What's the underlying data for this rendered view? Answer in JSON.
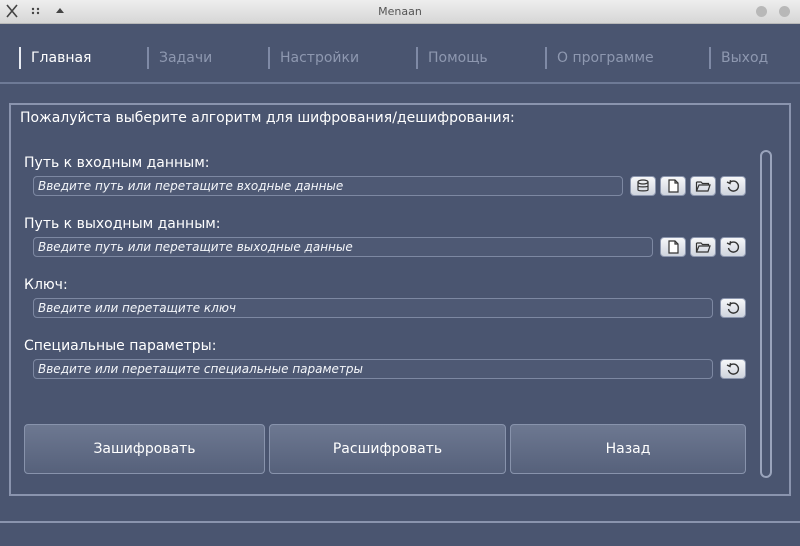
{
  "window": {
    "title": "Menaan"
  },
  "nav": [
    {
      "label": "Главная",
      "active": true
    },
    {
      "label": "Задачи",
      "active": false
    },
    {
      "label": "Настройки",
      "active": false
    },
    {
      "label": "Помощь",
      "active": false
    },
    {
      "label": "О программе",
      "active": false
    },
    {
      "label": "Выход",
      "active": false
    }
  ],
  "main": {
    "prompt": "Пожалуйста выберите алгоритм для шифрования/дешифрования:",
    "input_path": {
      "label": "Путь к входным данным:",
      "placeholder": "Введите путь или перетащите входные данные",
      "value": ""
    },
    "output_path": {
      "label": "Путь к выходным данным:",
      "placeholder": "Введите путь или перетащите выходные данные",
      "value": ""
    },
    "key": {
      "label": "Ключ:",
      "placeholder": "Введите или перетащите ключ",
      "value": ""
    },
    "special": {
      "label": "Специальные параметры:",
      "placeholder": "Введите или перетащите специальные параметры",
      "value": ""
    }
  },
  "buttons": {
    "encrypt": "Зашифровать",
    "decrypt": "Расшифровать",
    "back": "Назад"
  },
  "icons": {
    "database": "database-icon",
    "file": "file-icon",
    "folder": "folder-open-icon",
    "reset": "reset-icon"
  },
  "colors": {
    "background": "#4a5570",
    "frame": "#8a94ae",
    "text": "#ffffff",
    "nav_inactive": "#8e98b0"
  }
}
